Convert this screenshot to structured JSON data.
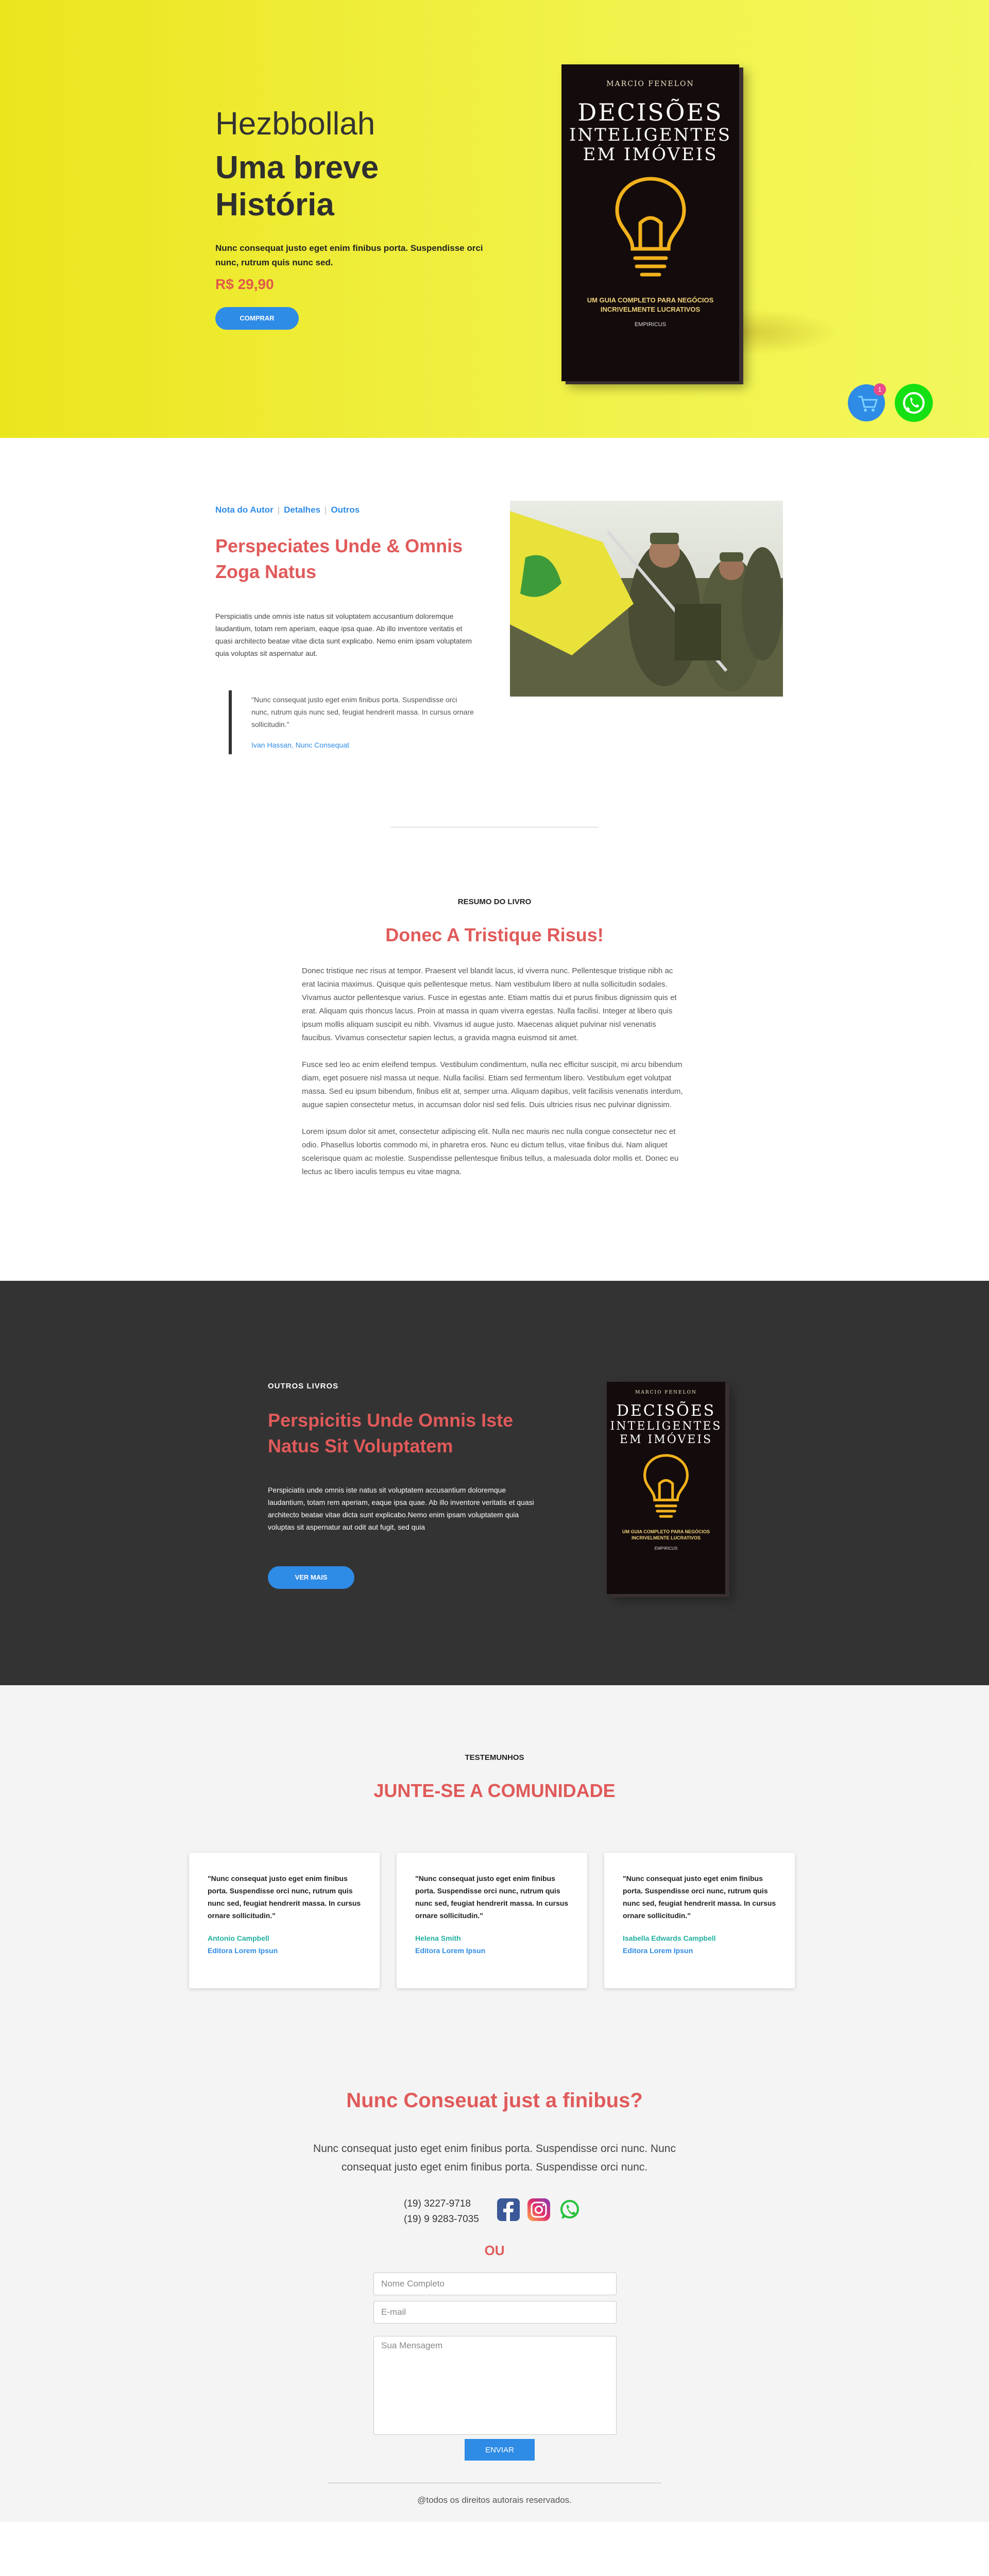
{
  "hero": {
    "kicker": "Hezbbollah",
    "title_line1": "Uma breve",
    "title_line2": "História",
    "description": "Nunc consequat justo eget enim finibus porta. Suspendisse orci nunc, rutrum quis nunc sed.",
    "price": "R$ 29,90",
    "buy_button": "COMPRAR",
    "cart_count": "1"
  },
  "book": {
    "author": "MARCIO FENELON",
    "title_line1": "DECISÕES",
    "title_line2": "INTELIGENTES",
    "title_line3": "EM IMÓVEIS",
    "subtitle_line1": "UM GUIA COMPLETO PARA NEGÓCIOS",
    "subtitle_line2": "INCRIVELMENTE LUCRATIVOS",
    "publisher": "EMPIRICUS",
    "bulb_color": "#f2b21c"
  },
  "about": {
    "tabs": [
      "Nota do Autor",
      "Detalhes",
      "Outros"
    ],
    "title": "Perspeciates Unde & Omnis Zoga Natus",
    "text": "Perspiciatis unde omnis iste natus sit voluptatem accusantium doloremque laudantium, totam rem aperiam, eaque ipsa quae. Ab illo inventore veritatis et quasi architecto beatae vitae dicta sunt explicabo. Nemo enim ipsam voluptatem quia voluptas sit aspernatur aut.",
    "quote": "\"Nunc consequat justo eget enim finibus porta. Suspendisse orci nunc, rutrum quis nunc sed, feugiat hendrerit massa. In cursus ornare sollicitudin.\"",
    "quote_author": "Ivan Hassan, Nunc Consequat"
  },
  "summary": {
    "kicker": "RESUMO DO LIVRO",
    "title": "Donec A Tristique Risus!",
    "paragraphs": [
      "Donec tristique nec risus at tempor. Praesent vel blandit lacus, id viverra nunc. Pellentesque tristique nibh ac erat lacinia maximus. Quisque quis pellentesque metus. Nam vestibulum libero at nulla sollicitudin sodales. Vivamus auctor pellentesque varius. Fusce in egestas ante. Etiam mattis dui et purus finibus dignissim quis et erat. Aliquam quis rhoncus lacus. Proin at massa in quam viverra egestas. Nulla facilisi. Integer at libero quis ipsum mollis aliquam suscipit eu nibh. Vivamus id augue justo. Maecenas aliquet pulvinar nisl venenatis faucibus. Vivamus consectetur sapien lectus, a gravida magna euismod sit amet.",
      "Fusce sed leo ac enim eleifend tempus. Vestibulum condimentum, nulla nec efficitur suscipit, mi arcu bibendum diam, eget posuere nisl massa ut neque. Nulla facilisi. Etiam sed fermentum libero. Vestibulum eget volutpat massa. Sed eu ipsum bibendum, finibus elit at, semper urna. Aliquam dapibus, velit facilisis venenatis interdum, augue sapien consectetur metus, in accumsan dolor nisl sed felis. Duis ultricies risus nec pulvinar dignissim.",
      "Lorem ipsum dolor sit amet, consectetur adipiscing elit. Nulla nec mauris nec nulla congue consectetur nec et odio. Phasellus lobortis commodo mi, in pharetra eros. Nunc eu dictum tellus, vitae finibus dui. Nam aliquet scelerisque quam ac molestie. Suspendisse pellentesque finibus tellus, a malesuada dolor mollis et. Donec eu lectus ac libero iaculis tempus eu vitae magna."
    ]
  },
  "others": {
    "kicker": "OUTROS LIVROS",
    "title": "Perspicitis Unde Omnis Iste Natus Sit Voluptatem",
    "text": "Perspiciatis unde omnis iste natus sit voluptatem accusantium doloremque laudantium, totam rem aperiam, eaque ipsa quae. Ab illo inventore veritatis et quasi architecto beatae vitae dicta sunt explicabo.Nemo enim ipsam voluptatem quia voluptas sit aspernatur aut odit aut fugit, sed quia",
    "button": "VER MAIS"
  },
  "testimonials": {
    "kicker": "TESTEMUNHOS",
    "title": "JUNTE-SE A COMUNIDADE",
    "items": [
      {
        "quote": "\"Nunc consequat justo eget enim finibus porta. Suspendisse orci nunc, rutrum quis nunc sed, feugiat hendrerit massa. In cursus ornare sollicitudin.\"",
        "name": "Antonio Campbell",
        "org": "Editora Lorem Ipsun"
      },
      {
        "quote": "\"Nunc consequat justo eget enim finibus porta. Suspendisse orci nunc, rutrum quis nunc sed, feugiat hendrerit massa. In cursus ornare sollicitudin.\"",
        "name": "Helena Smith",
        "org": "Editora Lorem Ipsun"
      },
      {
        "quote": "\"Nunc consequat justo eget enim finibus porta. Suspendisse orci nunc, rutrum quis nunc sed, feugiat hendrerit massa. In cursus ornare sollicitudin.\"",
        "name": "Isabella Edwards Campbell",
        "org": "Editora Lorem Ipsun"
      }
    ]
  },
  "contact": {
    "title": "Nunc Conseuat just a finibus?",
    "text": "Nunc consequat justo eget enim finibus porta. Suspendisse orci nunc. Nunc consequat justo eget enim finibus porta. Suspendisse orci nunc.",
    "phone1": "(19) 3227-9718",
    "phone2": "(19) 9 9283-7035",
    "or": "OU",
    "name_placeholder": "Nome Completo",
    "email_placeholder": "E-mail",
    "message_placeholder": "Sua Mensagem",
    "send": "ENVIAR",
    "copyright": "@todos os direitos autorais reservados."
  },
  "colors": {
    "accent": "#e05a5a",
    "link": "#2e8be6",
    "hero_yellow": "#ebe51e",
    "dark_section": "#333333",
    "whatsapp": "#14e014",
    "facebook": "#3b5998",
    "instagram": "#d6249f"
  }
}
